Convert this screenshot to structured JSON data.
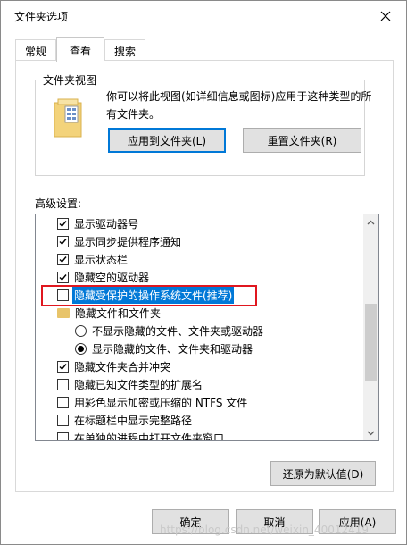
{
  "window": {
    "title": "文件夹选项"
  },
  "tabs": [
    {
      "label": "常规"
    },
    {
      "label": "查看"
    },
    {
      "label": "搜索"
    }
  ],
  "folder_views": {
    "legend": "文件夹视图",
    "description": "你可以将此视图(如详细信息或图标)应用于这种类型的所有文件夹。",
    "apply_button": "应用到文件夹(L)",
    "reset_button": "重置文件夹(R)"
  },
  "advanced": {
    "label": "高级设置:",
    "items": [
      {
        "type": "checkbox",
        "checked": true,
        "label": "显示驱动器号"
      },
      {
        "type": "checkbox",
        "checked": true,
        "label": "显示同步提供程序通知"
      },
      {
        "type": "checkbox",
        "checked": true,
        "label": "显示状态栏"
      },
      {
        "type": "checkbox",
        "checked": true,
        "label": "隐藏空的驱动器"
      },
      {
        "type": "checkbox",
        "checked": false,
        "label": "隐藏受保护的操作系统文件(推荐)",
        "selected": true
      },
      {
        "type": "folder",
        "label": "隐藏文件和文件夹"
      },
      {
        "type": "radio",
        "checked": false,
        "label": "不显示隐藏的文件、文件夹或驱动器"
      },
      {
        "type": "radio",
        "checked": true,
        "label": "显示隐藏的文件、文件夹和驱动器"
      },
      {
        "type": "checkbox",
        "checked": true,
        "label": "隐藏文件夹合并冲突"
      },
      {
        "type": "checkbox",
        "checked": false,
        "label": "隐藏已知文件类型的扩展名"
      },
      {
        "type": "checkbox",
        "checked": false,
        "label": "用彩色显示加密或压缩的 NTFS 文件"
      },
      {
        "type": "checkbox",
        "checked": false,
        "label": "在标题栏中显示完整路径"
      },
      {
        "type": "checkbox",
        "checked": false,
        "label": "在单独的进程中打开文件夹窗口"
      }
    ],
    "restore_button": "还原为默认值(D)"
  },
  "footer": {
    "ok": "确定",
    "cancel": "取消",
    "apply": "应用(A)"
  },
  "watermark": "https://blog.csdn.net/weixin_40012419",
  "colors": {
    "selection": "#0078d7",
    "annotation": "#e0171f",
    "folder": "#e8c46a"
  }
}
